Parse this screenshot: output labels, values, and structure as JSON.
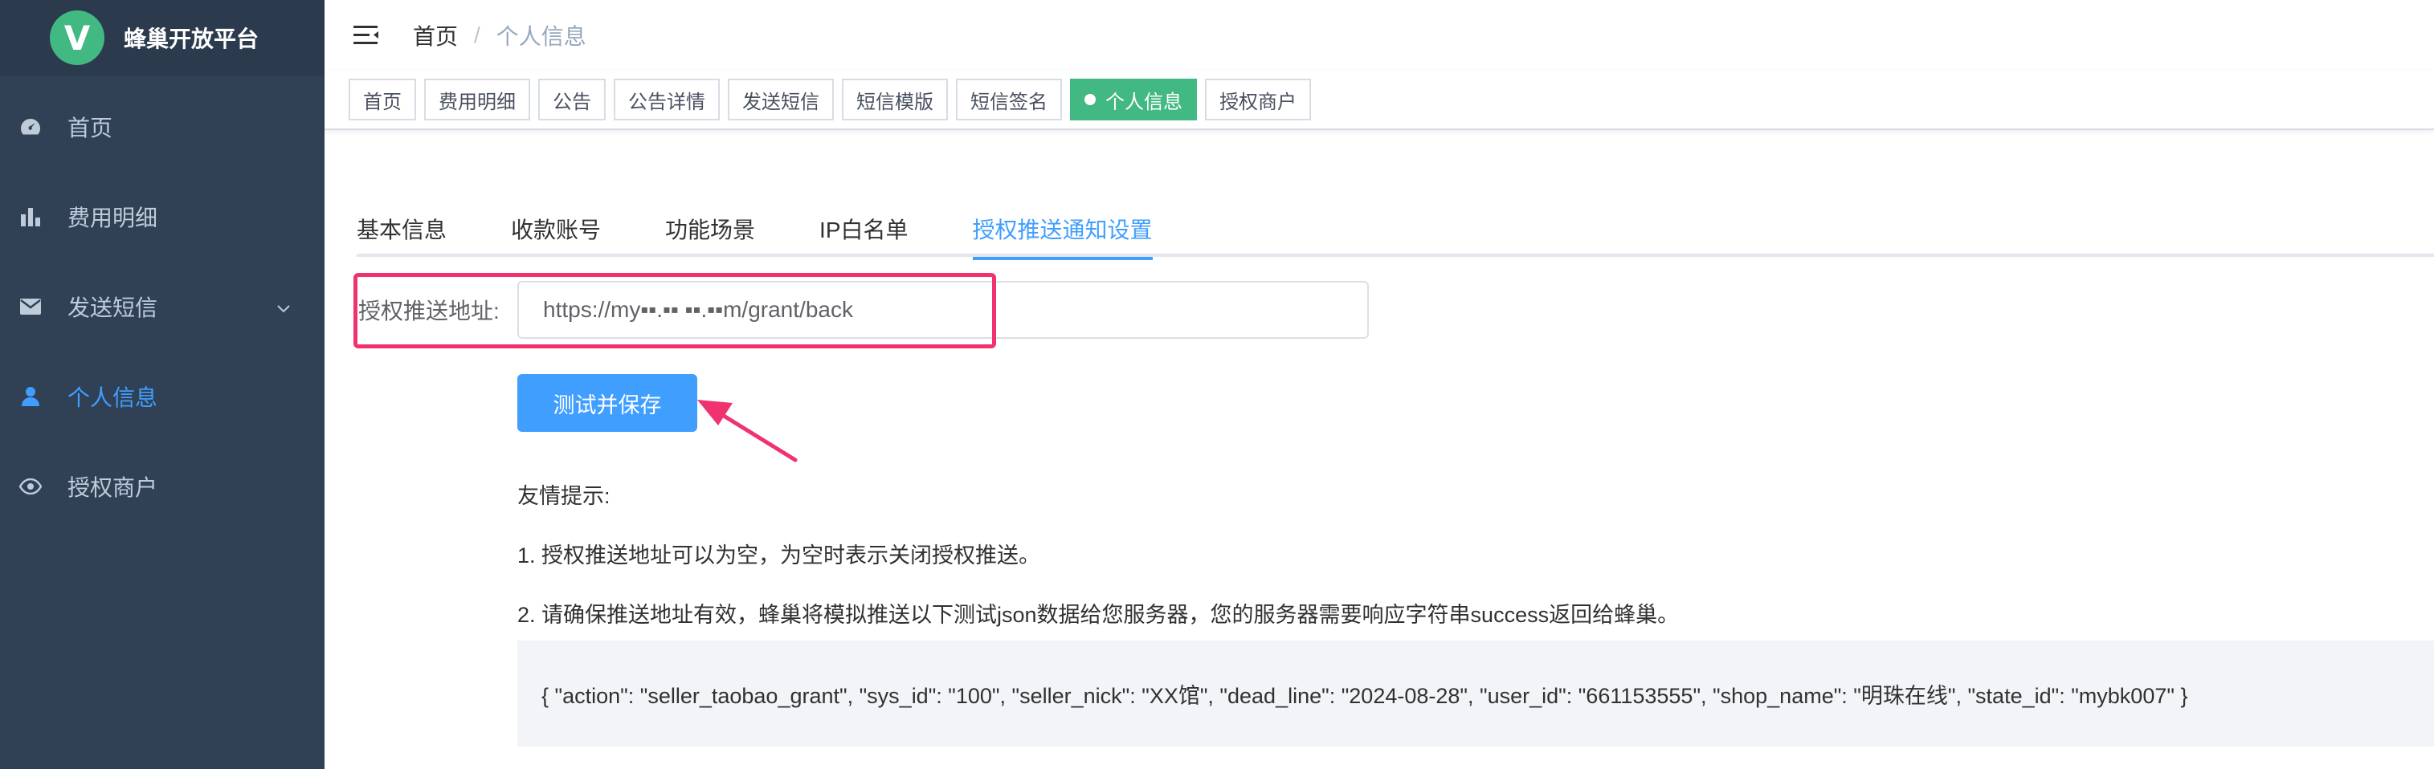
{
  "app": {
    "title": "蜂巢开放平台",
    "logo_letter": "V"
  },
  "sidebar": {
    "items": [
      {
        "label": "首页",
        "icon": "dashboard-icon",
        "active": false
      },
      {
        "label": "费用明细",
        "icon": "bar-chart-icon",
        "active": false
      },
      {
        "label": "发送短信",
        "icon": "mail-icon",
        "active": false,
        "has_submenu": true
      },
      {
        "label": "个人信息",
        "icon": "user-icon",
        "active": true
      },
      {
        "label": "授权商户",
        "icon": "eye-icon",
        "active": false
      }
    ]
  },
  "breadcrumb": {
    "home": "首页",
    "separator": "/",
    "current": "个人信息"
  },
  "tags": [
    "首页",
    "费用明细",
    "公告",
    "公告详情",
    "发送短信",
    "短信模版",
    "短信签名",
    "个人信息",
    "授权商户"
  ],
  "active_tag": "个人信息",
  "tabs": [
    "基本信息",
    "收款账号",
    "功能场景",
    "IP白名单",
    "授权推送通知设置"
  ],
  "active_tab": "授权推送通知设置",
  "form": {
    "label": "授权推送地址:",
    "value": "https://my▪▪.▪▪ ▪▪.▪▪m/grant/back",
    "button": "测试并保存"
  },
  "tips": {
    "heading": "友情提示:",
    "line1": "1. 授权推送地址可以为空，为空时表示关闭授权推送。",
    "line2": "2. 请确保推送地址有效，蜂巢将模拟推送以下测试json数据给您服务器，您的服务器需要响应字符串success返回给蜂巢。",
    "json_sample": "{ \"action\": \"seller_taobao_grant\", \"sys_id\": \"100\", \"seller_nick\": \"XX馆\", \"dead_line\": \"2024-08-28\", \"user_id\": \"661153555\", \"shop_name\": \"明珠在线\", \"state_id\": \"mybk007\" }"
  },
  "colors": {
    "sidebar_bg": "#304156",
    "accent": "#409eff",
    "tag_active": "#42b983",
    "annotation": "#f0336f"
  }
}
